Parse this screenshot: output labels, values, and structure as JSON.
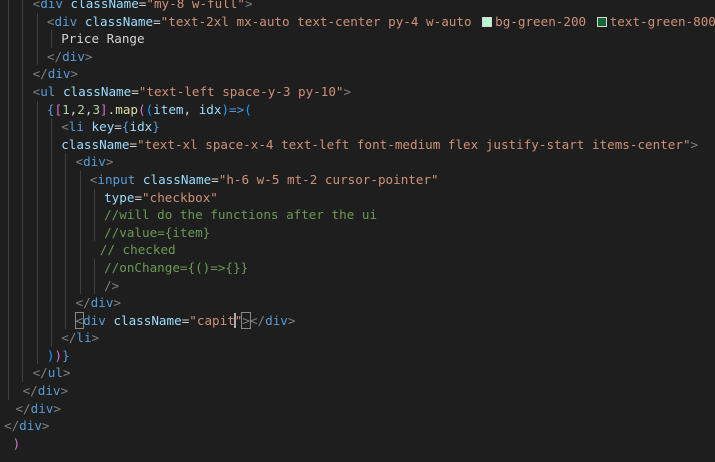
{
  "editor": {
    "lines": [
      {
        "indent": 2,
        "tokens": [
          {
            "c": "tk-punc",
            "t": "<"
          },
          {
            "c": "tk-tag",
            "t": "div"
          },
          {
            "c": "tk-text",
            "t": " "
          },
          {
            "c": "tk-attr",
            "t": "className"
          },
          {
            "c": "tk-text",
            "t": "="
          },
          {
            "c": "tk-str",
            "t": "\"my-8 w-full\""
          },
          {
            "c": "tk-punc",
            "t": ">"
          }
        ]
      },
      {
        "indent": 3,
        "tokens": [
          {
            "c": "tk-punc",
            "t": "<"
          },
          {
            "c": "tk-tag",
            "t": "div"
          },
          {
            "c": "tk-text",
            "t": " "
          },
          {
            "c": "tk-attr",
            "t": "className"
          },
          {
            "c": "tk-text",
            "t": "="
          },
          {
            "c": "tk-str",
            "t": "\"text-2xl mx-auto text-center py-4 w-auto "
          },
          {
            "swatch": "#bbf7d0"
          },
          {
            "c": "tk-str",
            "t": "bg-green-200 "
          },
          {
            "swatch": "#166534"
          },
          {
            "c": "tk-str",
            "t": "text-green-800\""
          },
          {
            "c": "tk-punc",
            "t": ">"
          }
        ]
      },
      {
        "indent": 4,
        "tokens": [
          {
            "c": "tk-text",
            "t": "Price Range"
          }
        ]
      },
      {
        "indent": 3,
        "tokens": [
          {
            "c": "tk-punc",
            "t": "</"
          },
          {
            "c": "tk-tag",
            "t": "div"
          },
          {
            "c": "tk-punc",
            "t": ">"
          }
        ]
      },
      {
        "indent": 2,
        "tokens": [
          {
            "c": "tk-punc",
            "t": "</"
          },
          {
            "c": "tk-tag",
            "t": "div"
          },
          {
            "c": "tk-punc",
            "t": ">"
          }
        ]
      },
      {
        "indent": 2,
        "tokens": [
          {
            "c": "tk-punc",
            "t": "<"
          },
          {
            "c": "tk-tag",
            "t": "ul"
          },
          {
            "c": "tk-text",
            "t": " "
          },
          {
            "c": "tk-attr",
            "t": "className"
          },
          {
            "c": "tk-text",
            "t": "="
          },
          {
            "c": "tk-str",
            "t": "\"text-left space-y-3 py-10\""
          },
          {
            "c": "tk-punc",
            "t": ">"
          }
        ]
      },
      {
        "indent": 3,
        "tokens": [
          {
            "c": "tk-brace",
            "t": "{"
          },
          {
            "c": "tk-bracket2",
            "t": "["
          },
          {
            "c": "tk-num",
            "t": "1"
          },
          {
            "c": "tk-text",
            "t": ","
          },
          {
            "c": "tk-num",
            "t": "2"
          },
          {
            "c": "tk-text",
            "t": ","
          },
          {
            "c": "tk-num",
            "t": "3"
          },
          {
            "c": "tk-bracket2",
            "t": "]"
          },
          {
            "c": "tk-text",
            "t": "."
          },
          {
            "c": "tk-fn",
            "t": "map"
          },
          {
            "c": "tk-bracket2",
            "t": "("
          },
          {
            "c": "tk-bracket3",
            "t": "("
          },
          {
            "c": "tk-param",
            "t": "item"
          },
          {
            "c": "tk-text",
            "t": ", "
          },
          {
            "c": "tk-param",
            "t": "idx"
          },
          {
            "c": "tk-bracket3",
            "t": ")"
          },
          {
            "c": "tk-arrow",
            "t": "=>"
          },
          {
            "c": "tk-bracket3",
            "t": "("
          }
        ]
      },
      {
        "indent": 4,
        "tokens": [
          {
            "c": "tk-punc",
            "t": "<"
          },
          {
            "c": "tk-tag",
            "t": "li"
          },
          {
            "c": "tk-text",
            "t": " "
          },
          {
            "c": "tk-attr",
            "t": "key"
          },
          {
            "c": "tk-text",
            "t": "="
          },
          {
            "c": "tk-brace",
            "t": "{"
          },
          {
            "c": "tk-param",
            "t": "idx"
          },
          {
            "c": "tk-brace",
            "t": "}"
          }
        ]
      },
      {
        "indent": 4,
        "tokens": [
          {
            "c": "tk-attr",
            "t": "className"
          },
          {
            "c": "tk-text",
            "t": "="
          },
          {
            "c": "tk-str",
            "t": "\"text-xl space-x-4 text-left font-medium flex justify-start items-center\""
          },
          {
            "c": "tk-punc",
            "t": ">"
          }
        ]
      },
      {
        "indent": 5,
        "tokens": [
          {
            "c": "tk-punc",
            "t": "<"
          },
          {
            "c": "tk-tag",
            "t": "div"
          },
          {
            "c": "tk-punc",
            "t": ">"
          }
        ]
      },
      {
        "indent": 6,
        "tokens": [
          {
            "c": "tk-punc",
            "t": "<"
          },
          {
            "c": "tk-tag",
            "t": "input"
          },
          {
            "c": "tk-text",
            "t": " "
          },
          {
            "c": "tk-attr",
            "t": "className"
          },
          {
            "c": "tk-text",
            "t": "="
          },
          {
            "c": "tk-str",
            "t": "\"h-6 w-5 mt-2 cursor-pointer\""
          }
        ]
      },
      {
        "indent": 7,
        "tokens": [
          {
            "c": "tk-attr",
            "t": "type"
          },
          {
            "c": "tk-text",
            "t": "="
          },
          {
            "c": "tk-str",
            "t": "\"checkbox\""
          }
        ]
      },
      {
        "indent": 7,
        "tokens": [
          {
            "c": "tk-comment",
            "t": "//will do the functions after the ui"
          }
        ]
      },
      {
        "indent": 7,
        "tokens": [
          {
            "c": "tk-comment",
            "t": "//value={item}"
          }
        ]
      },
      {
        "indent": 6.7,
        "tokens": [
          {
            "c": "tk-comment",
            "t": "// checked"
          }
        ]
      },
      {
        "indent": 7,
        "tokens": [
          {
            "c": "tk-comment",
            "t": "//onChange={()=>{}}"
          }
        ]
      },
      {
        "indent": 7,
        "tokens": [
          {
            "c": "tk-punc",
            "t": "/>"
          }
        ]
      },
      {
        "indent": 5,
        "tokens": [
          {
            "c": "tk-punc",
            "t": "</"
          },
          {
            "c": "tk-tag",
            "t": "div"
          },
          {
            "c": "tk-punc",
            "t": ">"
          }
        ]
      },
      {
        "indent": 5,
        "tokens": [
          {
            "c": "tk-punc",
            "t": "<",
            "box": true
          },
          {
            "c": "tk-tag",
            "t": "div"
          },
          {
            "c": "tk-text",
            "t": " "
          },
          {
            "c": "tk-attr",
            "t": "className"
          },
          {
            "c": "tk-text",
            "t": "="
          },
          {
            "c": "tk-str",
            "t": "\"capit"
          },
          {
            "cursor": true
          },
          {
            "c": "tk-str",
            "t": "\""
          },
          {
            "c": "tk-punc",
            "t": ">",
            "box": true
          },
          {
            "c": "tk-punc",
            "t": "</"
          },
          {
            "c": "tk-tag",
            "t": "div"
          },
          {
            "c": "tk-punc",
            "t": ">"
          }
        ]
      },
      {
        "indent": 4,
        "tokens": [
          {
            "c": "tk-punc",
            "t": "</"
          },
          {
            "c": "tk-tag",
            "t": "li"
          },
          {
            "c": "tk-punc",
            "t": ">"
          }
        ]
      },
      {
        "indent": 3,
        "tokens": [
          {
            "c": "tk-bracket3",
            "t": ")"
          },
          {
            "c": "tk-bracket2",
            "t": ")"
          },
          {
            "c": "tk-brace",
            "t": "}"
          }
        ]
      },
      {
        "indent": 2,
        "tokens": [
          {
            "c": "tk-punc",
            "t": "</"
          },
          {
            "c": "tk-tag",
            "t": "ul"
          },
          {
            "c": "tk-punc",
            "t": ">"
          }
        ]
      },
      {
        "indent": 1.3,
        "tokens": [
          {
            "c": "tk-punc",
            "t": "</"
          },
          {
            "c": "tk-tag",
            "t": "div"
          },
          {
            "c": "tk-punc",
            "t": ">"
          }
        ]
      },
      {
        "indent": 0.8,
        "tokens": [
          {
            "c": "tk-punc",
            "t": "</"
          },
          {
            "c": "tk-tag",
            "t": "div"
          },
          {
            "c": "tk-punc",
            "t": ">"
          }
        ]
      },
      {
        "indent": 0,
        "tokens": [
          {
            "c": "tk-punc",
            "t": "</"
          },
          {
            "c": "tk-tag",
            "t": "div"
          },
          {
            "c": "tk-punc",
            "t": ">"
          }
        ]
      },
      {
        "indent": 0.6,
        "tokens": [
          {
            "c": "tk-paren-pink",
            "t": ")"
          }
        ]
      }
    ]
  }
}
